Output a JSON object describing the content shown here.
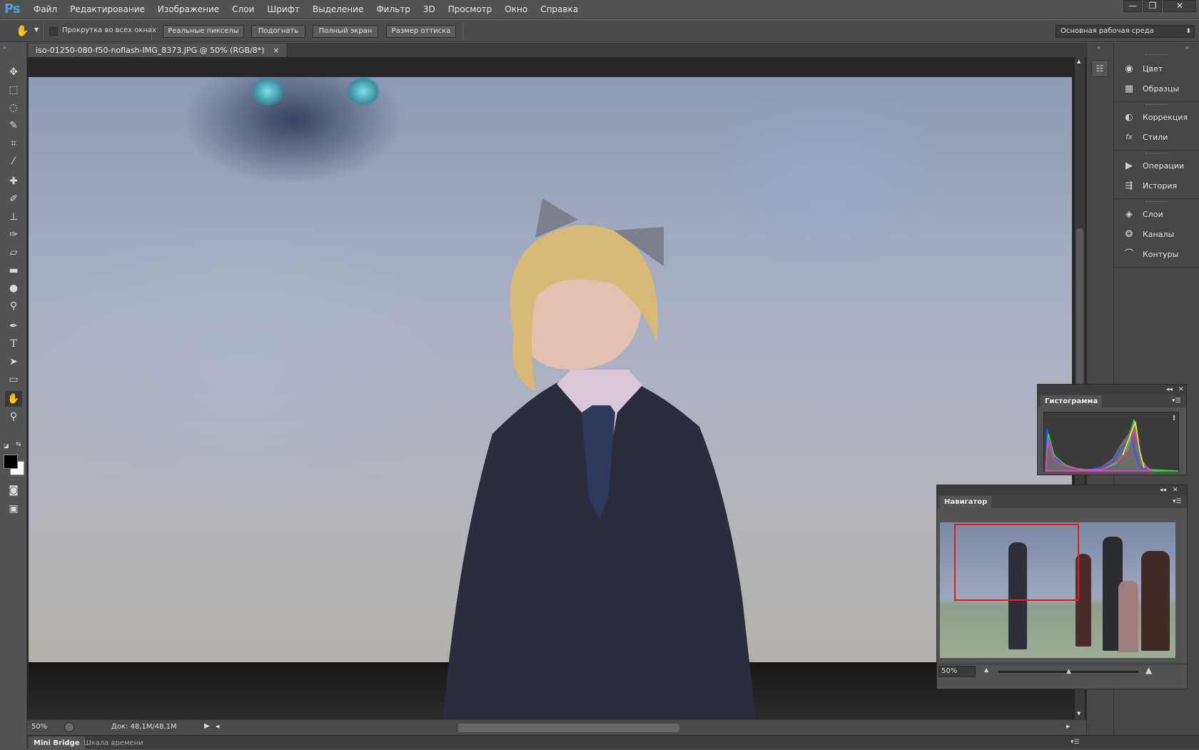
{
  "app": {
    "logo": "Ps"
  },
  "menu": [
    "Файл",
    "Редактирование",
    "Изображение",
    "Слои",
    "Шрифт",
    "Выделение",
    "Фильтр",
    "3D",
    "Просмотр",
    "Окно",
    "Справка"
  ],
  "window_controls": {
    "minimize": "—",
    "restore": "❐",
    "close": "✕"
  },
  "options_bar": {
    "scroll_all_windows_label": "Прокрутка во всех окнах",
    "scroll_all_windows_checked": false,
    "buttons": {
      "actual_pixels": "Реальные пикселы",
      "fit": "Подогнать",
      "full_screen": "Полный экран",
      "print_size": "Размер оттиска"
    },
    "workspace": "Основная рабочая среда"
  },
  "document": {
    "tab_title": "iso-01250-080-f50-noflash-IMG_8373.JPG @ 50% (RGB/8*)",
    "close": "×"
  },
  "status": {
    "zoom": "50%",
    "doc_info": "Док: 48,1M/48,1M"
  },
  "bottom_tabs": [
    "Mini Bridge",
    "Шкала времени"
  ],
  "dock": {
    "groups": [
      [
        {
          "label": "Цвет",
          "icon": "color-palette-icon"
        },
        {
          "label": "Образцы",
          "icon": "swatches-grid-icon"
        }
      ],
      [
        {
          "label": "Коррекция",
          "icon": "adjustments-icon"
        },
        {
          "label": "Стили",
          "icon": "styles-fx-icon"
        }
      ],
      [
        {
          "label": "Операции",
          "icon": "play-actions-icon"
        },
        {
          "label": "История",
          "icon": "history-icon"
        }
      ],
      [
        {
          "label": "Слои",
          "icon": "layers-icon"
        },
        {
          "label": "Каналы",
          "icon": "channels-icon"
        },
        {
          "label": "Контуры",
          "icon": "paths-icon"
        }
      ]
    ]
  },
  "histogram_panel": {
    "title": "Гистограмма",
    "warning": "!"
  },
  "navigator_panel": {
    "title": "Навигатор",
    "zoom": "50%",
    "zoom_level": 0.5
  },
  "colors": {
    "foreground": "#000000",
    "background": "#ffffff",
    "accent": "#4f9ed8",
    "navigator_box": "#e02020"
  }
}
